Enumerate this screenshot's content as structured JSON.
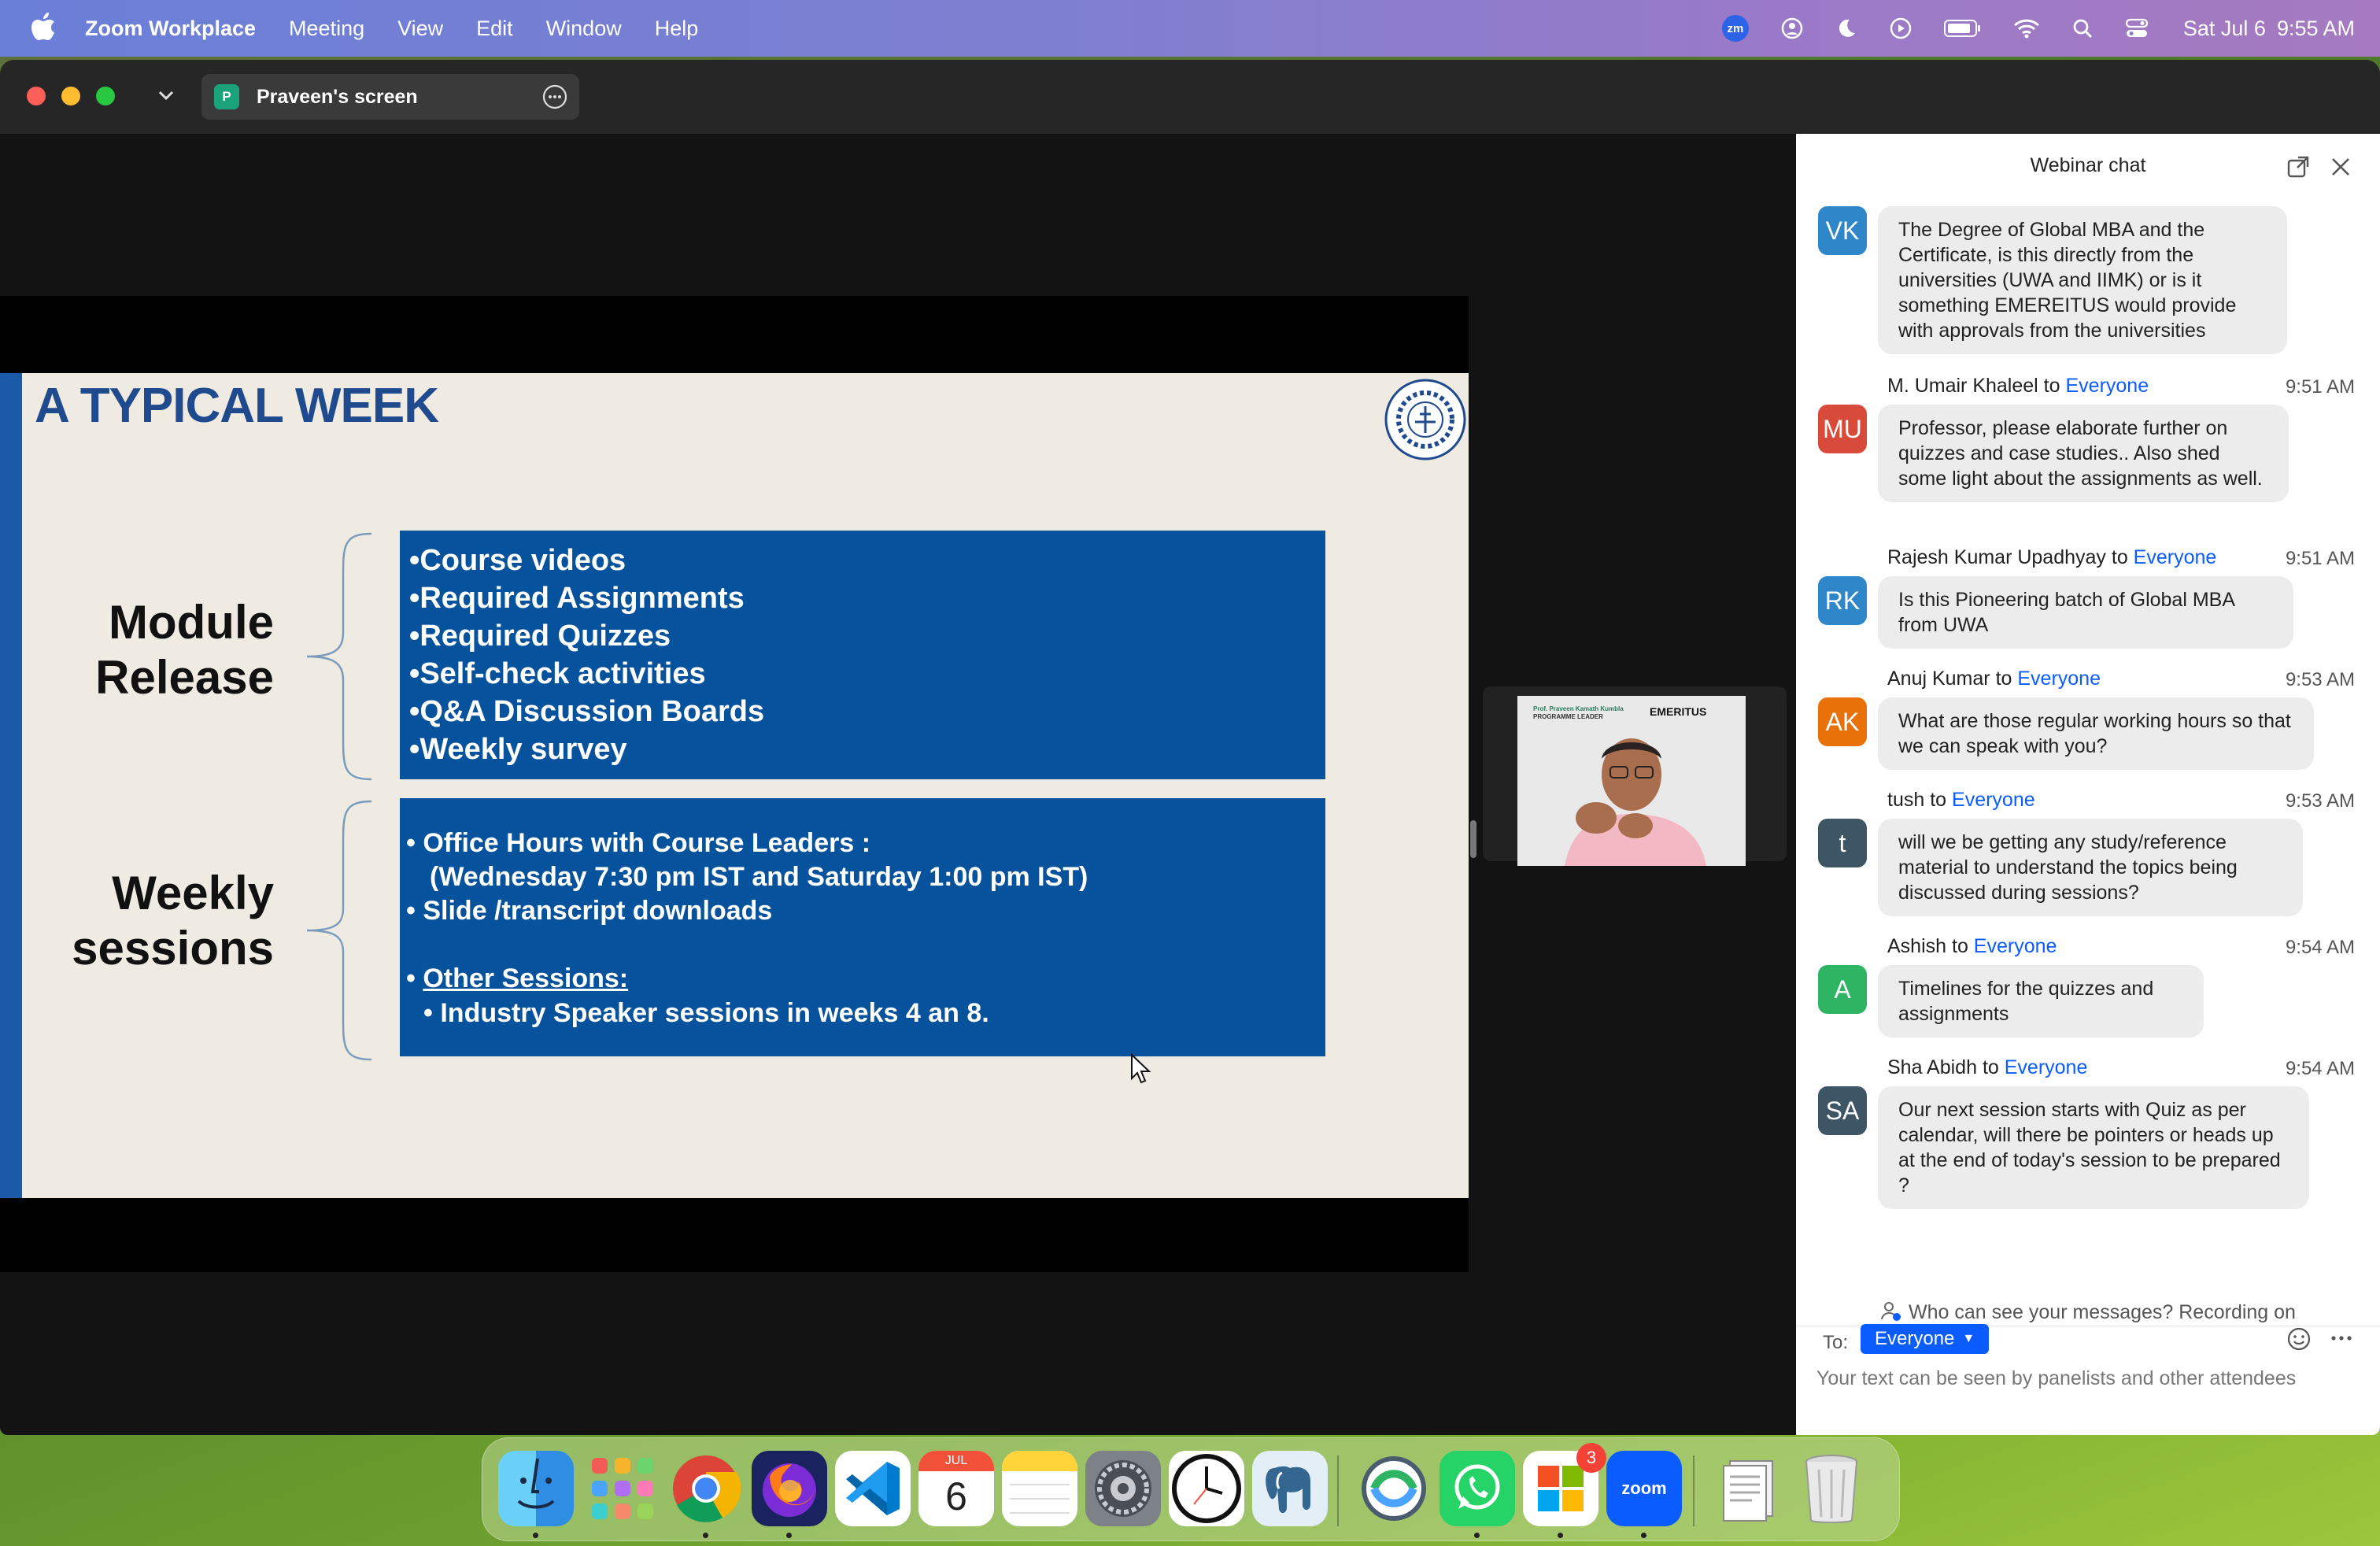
{
  "menubar": {
    "app_name": "Zoom Workplace",
    "menus": [
      "Meeting",
      "View",
      "Edit",
      "Window",
      "Help"
    ],
    "zoom_status_label": "zm",
    "date": "Sat Jul 6",
    "time": "9:55 AM"
  },
  "window": {
    "pill_avatar": "P",
    "pill_title": "Praveen's screen"
  },
  "slide": {
    "title": "A TYPICAL WEEK",
    "module_label_1": "Module",
    "module_label_2": "Release",
    "module_items": [
      "Course videos",
      "Required Assignments",
      "Required Quizzes",
      "Self-check activities",
      "Q&A Discussion Boards",
      "Weekly survey"
    ],
    "weekly_label_1": "Weekly",
    "weekly_label_2": "sessions",
    "session_line_1": "• Office Hours with Course Leaders :",
    "session_line_2": "(Wednesday 7:30 pm IST and Saturday 1:00 pm IST)",
    "session_line_3": "• Slide /transcript downloads",
    "session_bullet": "• ",
    "session_other": "Other Sessions:",
    "session_line_5": "• Industry Speaker sessions in weeks 4 an 8."
  },
  "speaker": {
    "line1": "Prof. Praveen Kamath Kumbla",
    "line2": "PROGRAMME LEADER",
    "brand": "EMERITUS"
  },
  "chat": {
    "title": "Webinar chat",
    "to_word": " to ",
    "messages": [
      {
        "initials": "VK",
        "color": "#2f86c8",
        "sender": "",
        "to": "",
        "time": "",
        "text": "The Degree of Global MBA and the Certificate, is this directly from the universities (UWA and IIMK) or is it something EMEREITUS would provide with approvals from the universities"
      },
      {
        "initials": "MU",
        "color": "#d84b3b",
        "sender": "M. Umair Khaleel",
        "to": "Everyone",
        "time": "9:51 AM",
        "text": "Professor, please elaborate further on quizzes and case studies.. Also shed some light about the assignments as well."
      },
      {
        "initials": "RK",
        "color": "#2f86c8",
        "sender": "Rajesh Kumar Upadhyay",
        "to": "Everyone",
        "time": "9:51 AM",
        "text": "Is this Pioneering batch of Global MBA from UWA"
      },
      {
        "initials": "AK",
        "color": "#e8710a",
        "sender": "Anuj Kumar",
        "to": "Everyone",
        "time": "9:53 AM",
        "text": "What are those regular working hours so that we can speak with you?"
      },
      {
        "initials": "t",
        "color": "#3e5566",
        "sender": "tush",
        "to": "Everyone",
        "time": "9:53 AM",
        "text": "will we be getting any study/reference material to understand the topics being discussed during sessions?"
      },
      {
        "initials": "A",
        "color": "#2fb463",
        "sender": "Ashish",
        "to": "Everyone",
        "time": "9:54 AM",
        "text": "Timelines for the quizzes and assignments"
      },
      {
        "initials": "SA",
        "color": "#3e5566",
        "sender": "Sha Abidh",
        "to": "Everyone",
        "time": "9:54 AM",
        "text": "Our next session starts with Quiz as per calendar, will there be pointers or heads up at the end of today's session to be prepared ?"
      }
    ],
    "privacy_text": "Who can see your messages? Recording on",
    "to_label": "To:",
    "recipient": "Everyone",
    "input_placeholder": "Your text can be seen by panelists and other attendees"
  },
  "dock": {
    "calendar_month": "JUL",
    "calendar_day": "6",
    "office_badge": "3",
    "zoom_label": "zoom"
  }
}
